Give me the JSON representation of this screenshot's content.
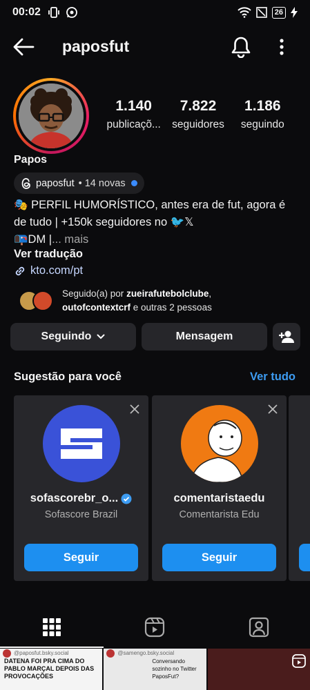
{
  "status_bar": {
    "time": "00:02",
    "battery": "26"
  },
  "header": {
    "username": "paposfut"
  },
  "profile": {
    "name": "Papos",
    "stats": [
      {
        "value": "1.140",
        "label": "publicaçõ..."
      },
      {
        "value": "7.822",
        "label": "seguidores"
      },
      {
        "value": "1.186",
        "label": "seguindo"
      }
    ],
    "threads": {
      "handle": "paposfut",
      "sub": "• 14 novas"
    },
    "bio_line1": "🎭 PERFIL HUMORÍSTICO, antes era de fut, agora é",
    "bio_line2": "de tudo | +150k seguidores no 🐦𝕏",
    "bio_line3": "📭DM |",
    "bio_more": "... mais",
    "translate": "Ver tradução",
    "link": "kto.com/pt",
    "followed_by_prefix": "Seguido(a) por ",
    "followed_by_user1": "zueirafutebolclube",
    "followed_by_sep": ",",
    "followed_by_user2": "outofcontextcrf",
    "followed_by_suffix": " e outras 2 pessoas"
  },
  "actions": {
    "following": "Seguindo",
    "message": "Mensagem"
  },
  "suggestions": {
    "title": "Sugestão para você",
    "see_all": "Ver tudo",
    "cards": [
      {
        "username": "sofascorebr_o...",
        "full_name": "Sofascore Brazil",
        "verified": true,
        "button": "Seguir",
        "color": "#3a52d8"
      },
      {
        "username": "comentaristaedu",
        "full_name": "Comentarista Edu",
        "verified": false,
        "button": "Seguir",
        "color": "#f07a12"
      }
    ]
  },
  "posts": [
    {
      "handle": "@paposfut.bsky.social",
      "text": "DATENA FOI PRA CIMA DO PABLO MARÇAL DEPOIS DAS PROVOCAÇÕES"
    },
    {
      "handle": "@samengo.bsky.social",
      "text": "Conversando sozinho no Twitter PaposFut?"
    }
  ],
  "colors": {
    "accent": "#1d8ff0",
    "link": "#3d9cf2",
    "background": "#0b0b0d",
    "card": "#27272b"
  }
}
